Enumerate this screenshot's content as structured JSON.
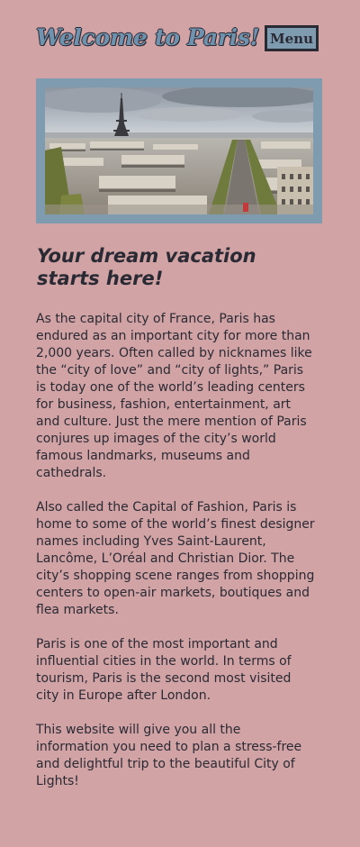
{
  "header": {
    "title": "Welcome to Paris!",
    "menu_label": "Menu"
  },
  "hero": {
    "alt": "Paris skyline with Eiffel Tower"
  },
  "main": {
    "heading": "Your dream vacation starts here!",
    "paragraphs": [
      "As the capital city of France, Paris has endured as an important city for more than 2,000 years. Often called by nicknames like the “city of love” and “city of lights,” Paris is today one of the world’s leading centers for business, fashion, entertainment, art and culture. Just the mere mention of Paris conjures up images of the city’s world famous landmarks, museums and cathedrals.",
      "Also called the Capital of Fashion, Paris is home to some of the world’s finest designer names including Yves Saint-Laurent, Lancôme, L’Oréal and Christian Dior. The city’s shopping scene ranges from shopping centers to open-air markets, boutiques and flea markets.",
      "Paris is one of the most important and influential cities in the world. In terms of tourism, Paris is the second most visited city in Europe after London.",
      "This website will give you all the information you need to plan a stress-free and delightful trip to the beautiful City of Lights!"
    ]
  },
  "colors": {
    "background": "#d1a3a4",
    "accent": "#7e9bb0",
    "title_fill": "#6f93ae",
    "text": "#2a2a35"
  }
}
